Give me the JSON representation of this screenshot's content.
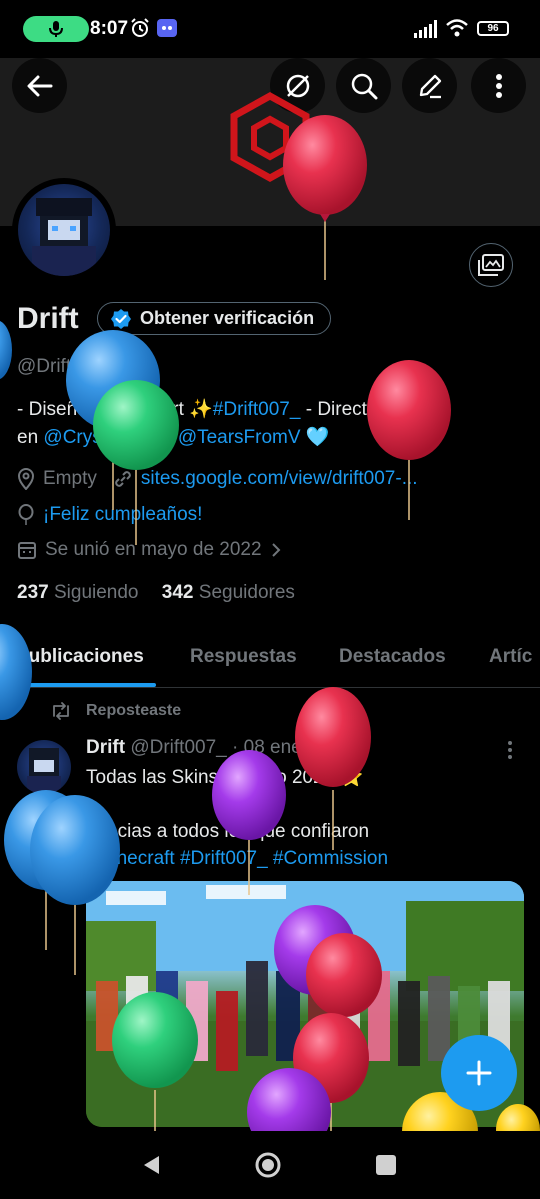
{
  "status_bar": {
    "time": "8:07",
    "battery": "96",
    "icons": [
      "mic-icon",
      "alarm-icon",
      "discord-icon",
      "signal-icon",
      "wifi-icon",
      "battery-icon"
    ]
  },
  "header": {
    "icons": [
      "back-arrow-icon",
      "translate-off-icon",
      "search-icon",
      "edit-icon",
      "more-vertical-icon"
    ]
  },
  "profile": {
    "name": "Drift",
    "verify_label": "Obtener verificación",
    "handle": "@Drift007_",
    "bio_line1_a": "- Diseñador Pixelart ✨",
    "bio_line1_link": "#Drift007_",
    "bio_line1_b": " - Director Auxiliar",
    "bio_line2_a": "en ",
    "bio_line2_link1": "@CrystStudio",
    "bio_line2_b": "  - ",
    "bio_line2_link2": "@TearsFromV",
    "bio_line2_c": " 🩵",
    "location": "Empty",
    "website": "sites.google.com/view/drift007-...",
    "birthday": "¡Feliz cumpleaños!",
    "joined": "Se unió en mayo de 2022",
    "following_count": "237",
    "following_label": "Siguiendo",
    "followers_count": "342",
    "followers_label": "Seguidores"
  },
  "tabs": [
    "Publicaciones",
    "Respuestas",
    "Destacados",
    "Artíc"
  ],
  "post": {
    "repost_label": "Reposteaste",
    "author": "Drift",
    "handle": "@Drift007_",
    "date": "· 08 ene",
    "line1": "Todas las Skins del Año 2025 ⭐",
    "line2": "Gracias a todos los que confiaron",
    "hashtags": "#Minecraft #Drift007_ #Commission"
  },
  "colors": {
    "accent": "#1d9bf0",
    "background": "#000000",
    "muted": "#71767b",
    "text": "#e7e9ea"
  }
}
